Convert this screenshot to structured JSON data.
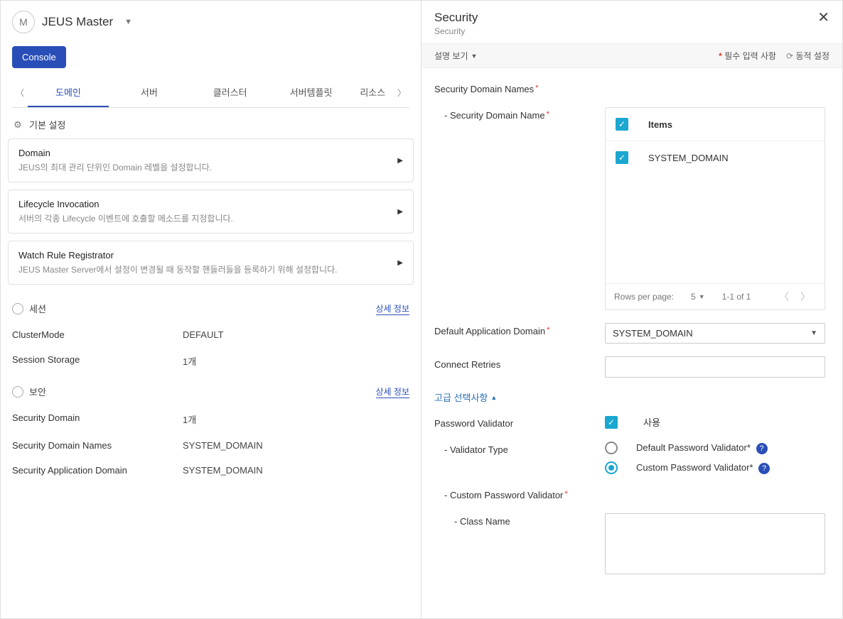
{
  "header": {
    "avatar_initial": "M",
    "master_label": "JEUS Master",
    "console_btn": "Console"
  },
  "tabs": {
    "items": [
      "도메인",
      "서버",
      "클러스터",
      "서버템플릿",
      "리소스"
    ],
    "active_index": 0
  },
  "basic_section": {
    "title": "기본 설정",
    "cards": [
      {
        "title": "Domain",
        "desc": "JEUS의 최대 관리 단위인 Domain 레벨을 설정합니다."
      },
      {
        "title": "Lifecycle Invocation",
        "desc": "서버의 각종 Lifecycle 이벤트에 호출할 메소드를 지정합니다."
      },
      {
        "title": "Watch Rule Registrator",
        "desc": "JEUS Master Server에서 설정이 변경될 때 동작할 핸들러들을 등록하기 위해 설정합니다."
      }
    ]
  },
  "session_section": {
    "title": "세션",
    "detail_link": "상세 정보",
    "rows": [
      {
        "label": "ClusterMode",
        "value": "DEFAULT"
      },
      {
        "label": "Session Storage",
        "value": "1개"
      }
    ]
  },
  "security_section": {
    "title": "보안",
    "detail_link": "상세 정보",
    "rows": [
      {
        "label": "Security Domain",
        "value": "1개"
      },
      {
        "label": "Security Domain Names",
        "value": "SYSTEM_DOMAIN"
      },
      {
        "label": "Security Application Domain",
        "value": "SYSTEM_DOMAIN"
      }
    ]
  },
  "right": {
    "title": "Security",
    "breadcrumb": "Security",
    "toolbar": {
      "view_toggle": "설명 보기",
      "required_label": "필수 입력 사항",
      "dynamic_label": "동적 설정"
    },
    "fields": {
      "security_domain_names_label": "Security Domain Names",
      "security_domain_name_label": "- Security Domain Name",
      "items_table": {
        "header": "Items",
        "rows": [
          "SYSTEM_DOMAIN"
        ],
        "rows_per_page_label": "Rows per page:",
        "page_size": "5",
        "range": "1-1 of 1"
      },
      "default_app_domain_label": "Default Application Domain",
      "default_app_domain_value": "SYSTEM_DOMAIN",
      "connect_retries_label": "Connect Retries",
      "advanced_toggle": "고급 선택사항",
      "password_validator_label": "Password Validator",
      "use_label": "사용",
      "validator_type_label": "- Validator Type",
      "validator_options": {
        "default": "Default Password Validator",
        "custom": "Custom Password Validator"
      },
      "custom_pw_validator_label": "- Custom Password Validator",
      "class_name_label": "- Class Name"
    }
  }
}
